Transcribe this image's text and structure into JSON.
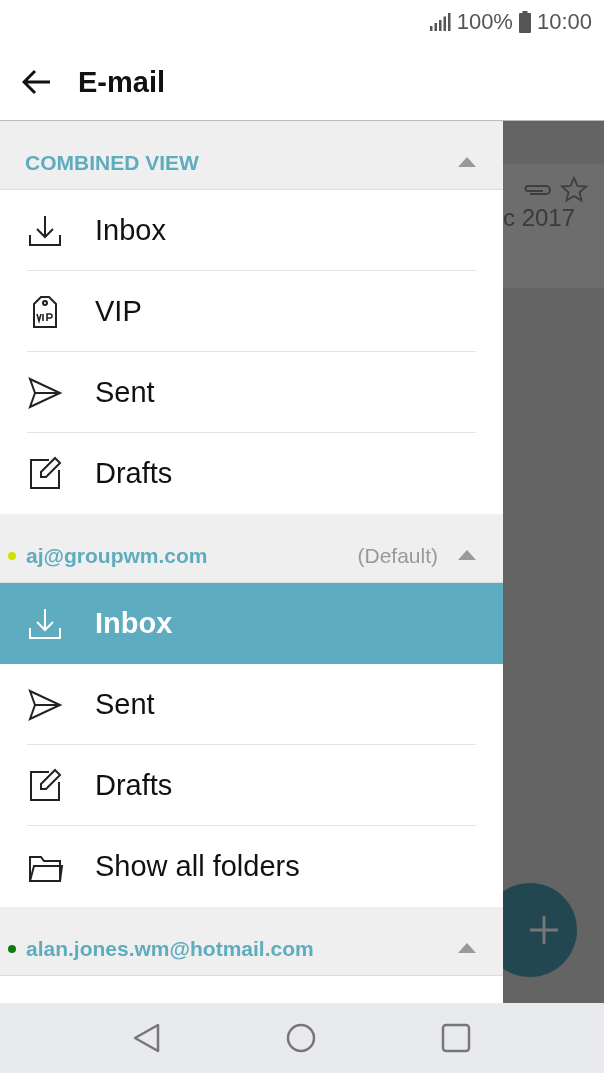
{
  "status_bar": {
    "battery": "100%",
    "time": "10:00"
  },
  "app_bar": {
    "title": "E-mail"
  },
  "sections": [
    {
      "title": "COMBINED VIEW",
      "kind": "combined",
      "expanded": true,
      "items": [
        {
          "label": "Inbox",
          "kind": "inbox",
          "selected": false
        },
        {
          "label": "VIP",
          "kind": "vip",
          "selected": false
        },
        {
          "label": "Sent",
          "kind": "sent",
          "selected": false
        },
        {
          "label": "Drafts",
          "kind": "drafts",
          "selected": false
        }
      ]
    },
    {
      "title": "aj@groupwm.com",
      "kind": "account",
      "color": "#d4e000",
      "badge": "(Default)",
      "expanded": true,
      "items": [
        {
          "label": "Inbox",
          "kind": "inbox",
          "selected": true
        },
        {
          "label": "Sent",
          "kind": "sent",
          "selected": false
        },
        {
          "label": "Drafts",
          "kind": "drafts",
          "selected": false
        },
        {
          "label": "Show all folders",
          "kind": "folder",
          "selected": false
        }
      ]
    },
    {
      "title": "alan.jones.wm@hotmail.com",
      "kind": "account",
      "color": "#117a11",
      "expanded": true
    }
  ],
  "background": {
    "date": "c 2017"
  }
}
